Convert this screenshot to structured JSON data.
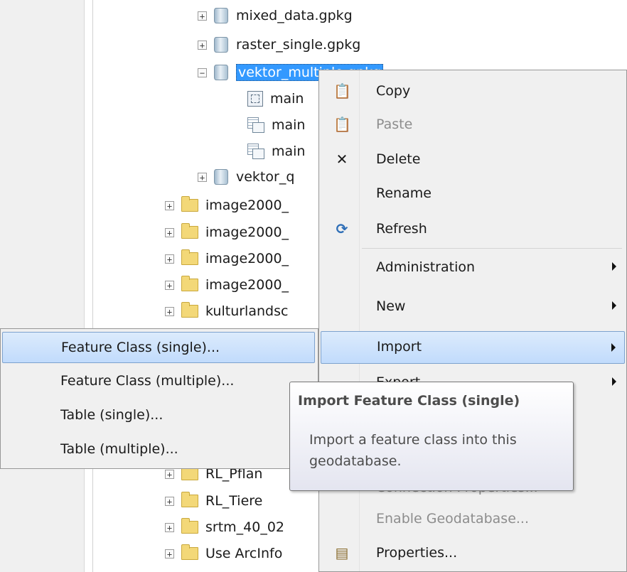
{
  "tree": {
    "rows": [
      {
        "label": "mixed_data.gpkg"
      },
      {
        "label": "raster_single.gpkg"
      },
      {
        "label": "vektor_multiple.gpkg"
      },
      {
        "label": "main"
      },
      {
        "label": "main"
      },
      {
        "label": "main"
      },
      {
        "label": "vektor_q"
      },
      {
        "label": "image2000_"
      },
      {
        "label": "image2000_"
      },
      {
        "label": "image2000_"
      },
      {
        "label": "image2000_"
      },
      {
        "label": "kulturlandsc"
      },
      {
        "label": "RL_Pflan"
      },
      {
        "label": "RL_Tiere"
      },
      {
        "label": "srtm_40_02"
      },
      {
        "label": "Use ArcInfo"
      }
    ]
  },
  "context_menu": {
    "items": [
      {
        "label": "Copy",
        "icon": "copy-icon"
      },
      {
        "label": "Paste",
        "icon": "paste-icon"
      },
      {
        "label": "Delete",
        "icon": "delete-icon"
      },
      {
        "label": "Rename"
      },
      {
        "label": "Refresh",
        "icon": "refresh-icon"
      },
      {
        "label": "Administration"
      },
      {
        "label": "New"
      },
      {
        "label": "Import"
      },
      {
        "label": "Export"
      },
      {
        "label": "Connection Properties..."
      },
      {
        "label": "Enable Geodatabase..."
      },
      {
        "label": "Properties...",
        "icon": "properties-icon"
      }
    ]
  },
  "submenu": {
    "items": [
      {
        "label": "Feature Class (single)..."
      },
      {
        "label": "Feature Class (multiple)..."
      },
      {
        "label": "Table (single)..."
      },
      {
        "label": "Table (multiple)..."
      }
    ]
  },
  "tooltip": {
    "title": "Import Feature Class (single)",
    "description": "Import a feature class into this geodatabase."
  },
  "colors": {
    "highlight": "#c1dbfc",
    "selection": "#3399ff",
    "menu_bg": "#f0f0f0"
  }
}
